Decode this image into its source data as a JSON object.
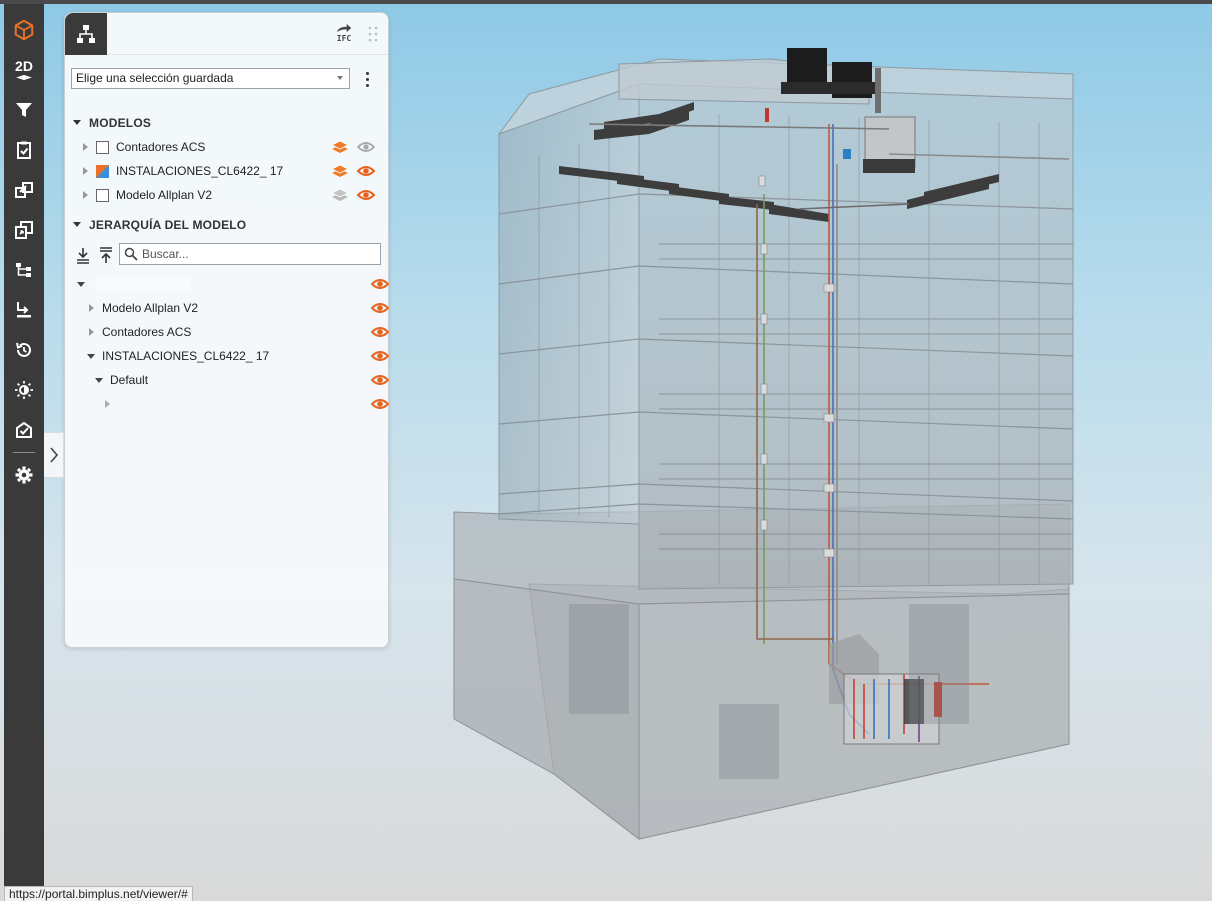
{
  "toolbar": {
    "items": [
      {
        "name": "bimplus-logo-icon"
      },
      {
        "name": "2d-icon",
        "label": "2D"
      },
      {
        "name": "filter-icon"
      },
      {
        "name": "clipboard-check-icon"
      },
      {
        "name": "copy-arrow-icon"
      },
      {
        "name": "copy-out-icon"
      },
      {
        "name": "hierarchy-icon"
      },
      {
        "name": "tree-move-icon"
      },
      {
        "name": "history-icon"
      },
      {
        "name": "brightness-icon"
      },
      {
        "name": "check-shield-icon"
      },
      {
        "name": "gear-icon"
      }
    ],
    "bg_color": "#3a3a3a",
    "accent_color": "#e8722a"
  },
  "panel": {
    "ifc_label": "IFC",
    "saved_selection": {
      "placeholder": "Elige una selección guardada",
      "value": "Elige una selección guardada"
    },
    "models_title": "MODELOS",
    "models": [
      {
        "label": "Contadores ACS",
        "checkbox": "unchecked",
        "layers": "active",
        "eye": "hidden"
      },
      {
        "label": "INSTALACIONES_CL6422_ 17",
        "checkbox": "partial",
        "layers": "active",
        "eye": "visible"
      },
      {
        "label": "Modelo Allplan V2",
        "checkbox": "unchecked",
        "layers": "inactive",
        "eye": "visible"
      }
    ],
    "hierarchy_title": "JERARQUÍA DEL MODELO",
    "search": {
      "placeholder": "Buscar...",
      "value": ""
    },
    "tree": [
      {
        "label": "",
        "level": 0,
        "expanded": true
      },
      {
        "label": "Modelo Allplan V2",
        "level": 1,
        "expanded": false
      },
      {
        "label": "Contadores ACS",
        "level": 1,
        "expanded": false
      },
      {
        "label": "INSTALACIONES_CL6422_ 17",
        "level": 1,
        "expanded": true
      },
      {
        "label": "Default",
        "level": 2,
        "expanded": true
      },
      {
        "label": "",
        "level": 3,
        "expanded": false
      }
    ]
  },
  "status_bar": {
    "url": "https://portal.bimplus.net/viewer/#"
  },
  "colors": {
    "eye_visible": "#e8621e",
    "eye_hidden": "#9a9a9a",
    "layers_active": "#f07a2a",
    "layers_inactive": "#b0b0b0"
  }
}
